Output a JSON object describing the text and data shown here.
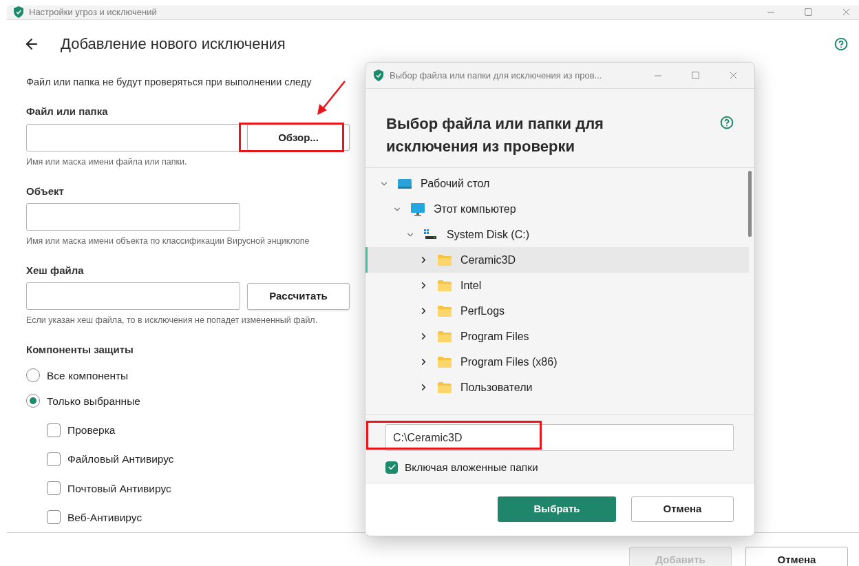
{
  "window": {
    "title": "Настройки угроз и исключений"
  },
  "page": {
    "title": "Добавление нового исключения",
    "description": "Файл или папка не будут проверяться при выполнении следу"
  },
  "fields": [
    {
      "label": "Файл или папка",
      "button": "Обзор...",
      "hint": "Имя или маска имени файла или папки.",
      "highlighted": true
    },
    {
      "label": "Объект",
      "hint": "Имя или маска имени объекта по классификации Вирусной энциклопе"
    },
    {
      "label": "Хеш файла",
      "button": "Рассчитать",
      "hint": "Если указан хеш файла, то в исключения не попадет измененный файл."
    }
  ],
  "components": {
    "title": "Компоненты защиты",
    "options": [
      {
        "label": "Все компоненты",
        "selected": false
      },
      {
        "label": "Только выбранные",
        "selected": true
      }
    ],
    "checkboxes": [
      {
        "label": "Проверка",
        "checked": false
      },
      {
        "label": "Файловый Антивирус",
        "checked": false
      },
      {
        "label": "Почтовый Антивирус",
        "checked": false
      },
      {
        "label": "Веб-Антивирус",
        "checked": false
      }
    ]
  },
  "footer": {
    "buttons": [
      {
        "label": "Добавить",
        "disabled": true
      },
      {
        "label": "Отмена",
        "disabled": false
      }
    ]
  },
  "dialog": {
    "title": "Выбор файла или папки для исключения из пров...",
    "heading": "Выбор файла или папки для исключения из проверки",
    "tree": [
      {
        "label": "Рабочий стол",
        "kind": "desktop",
        "expanded": true,
        "selected": false,
        "children": [
          {
            "label": "Этот компьютер",
            "kind": "computer",
            "expanded": true,
            "selected": false,
            "children": [
              {
                "label": "System Disk (C:)",
                "kind": "disk",
                "expanded": true,
                "selected": false,
                "children": [
                  {
                    "label": "Ceramic3D",
                    "kind": "folder",
                    "expanded": false,
                    "selected": true
                  },
                  {
                    "label": "Intel",
                    "kind": "folder",
                    "expanded": false,
                    "selected": false
                  },
                  {
                    "label": "PerfLogs",
                    "kind": "folder",
                    "expanded": false,
                    "selected": false
                  },
                  {
                    "label": "Program Files",
                    "kind": "folder",
                    "expanded": false,
                    "selected": false
                  },
                  {
                    "label": "Program Files (x86)",
                    "kind": "folder",
                    "expanded": false,
                    "selected": false
                  },
                  {
                    "label": "Пользователи",
                    "kind": "folder",
                    "expanded": false,
                    "selected": false
                  }
                ]
              }
            ]
          }
        ]
      }
    ],
    "path": "C:\\Ceramic3D",
    "path_highlighted": true,
    "include_subfolders": {
      "label": "Включая вложенные папки",
      "checked": true
    },
    "buttons": [
      {
        "label": "Выбрать",
        "kind": "primary"
      },
      {
        "label": "Отмена",
        "kind": "secondary"
      }
    ]
  }
}
